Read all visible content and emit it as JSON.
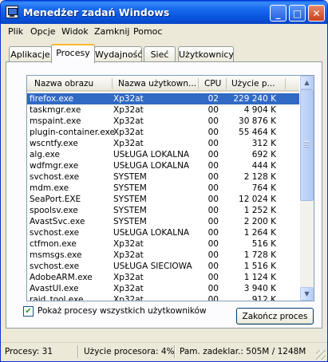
{
  "window": {
    "title": "Menedżer zadań Windows"
  },
  "title_buttons": {
    "minimize": "_",
    "maximize": "□",
    "close": "✕"
  },
  "menu": [
    "Plik",
    "Opcje",
    "Widok",
    "Zamknij",
    "Pomoc"
  ],
  "tabs": [
    "Aplikacje",
    "Procesy",
    "Wydajność",
    "Sieć",
    "Użytkownicy"
  ],
  "active_tab": "Procesy",
  "table": {
    "columns": [
      "Nazwa obrazu",
      "Nazwa użytkown...",
      "CPU",
      "Użycie p..."
    ],
    "rows": [
      [
        "firefox.exe",
        "Xp32at",
        "02",
        "229 240 K"
      ],
      [
        "taskmgr.exe",
        "Xp32at",
        "00",
        "4 904 K"
      ],
      [
        "mspaint.exe",
        "Xp32at",
        "00",
        "30 876 K"
      ],
      [
        "plugin-container.exe",
        "Xp32at",
        "00",
        "55 464 K"
      ],
      [
        "wscntfy.exe",
        "Xp32at",
        "00",
        "312 K"
      ],
      [
        "alg.exe",
        "USŁUGA LOKALNA",
        "00",
        "692 K"
      ],
      [
        "wdfmgr.exe",
        "USŁUGA LOKALNA",
        "00",
        "444 K"
      ],
      [
        "svchost.exe",
        "SYSTEM",
        "00",
        "2 128 K"
      ],
      [
        "mdm.exe",
        "SYSTEM",
        "00",
        "764 K"
      ],
      [
        "SeaPort.EXE",
        "SYSTEM",
        "00",
        "12 024 K"
      ],
      [
        "spoolsv.exe",
        "SYSTEM",
        "00",
        "1 252 K"
      ],
      [
        "AvastSvc.exe",
        "SYSTEM",
        "00",
        "2 200 K"
      ],
      [
        "svchost.exe",
        "USŁUGA LOKALNA",
        "00",
        "1 264 K"
      ],
      [
        "ctfmon.exe",
        "Xp32at",
        "00",
        "516 K"
      ],
      [
        "msmsgs.exe",
        "Xp32at",
        "00",
        "1 728 K"
      ],
      [
        "svchost.exe",
        "USŁUGA SIECIOWA",
        "00",
        "1 516 K"
      ],
      [
        "AdobeARM.exe",
        "Xp32at",
        "00",
        "1 124 K"
      ],
      [
        "AvastUI.exe",
        "Xp32at",
        "00",
        "3 940 K"
      ],
      [
        "raid_tool.exe",
        "Xp32at",
        "00",
        "912 K"
      ]
    ],
    "selected_row": 0
  },
  "scroll": {
    "up": "▲",
    "down": "▼"
  },
  "show_all_checkbox": {
    "label": "Pokaż procesy wszystkich użytkowników",
    "checked": true,
    "mark": "✔"
  },
  "end_process_button": "Zakończ proces",
  "status": {
    "processes": "Procesy: 31",
    "cpu": "Użycie procesora: 4%",
    "memory": "Pam. zadeklar.: 505M / 1248M"
  }
}
